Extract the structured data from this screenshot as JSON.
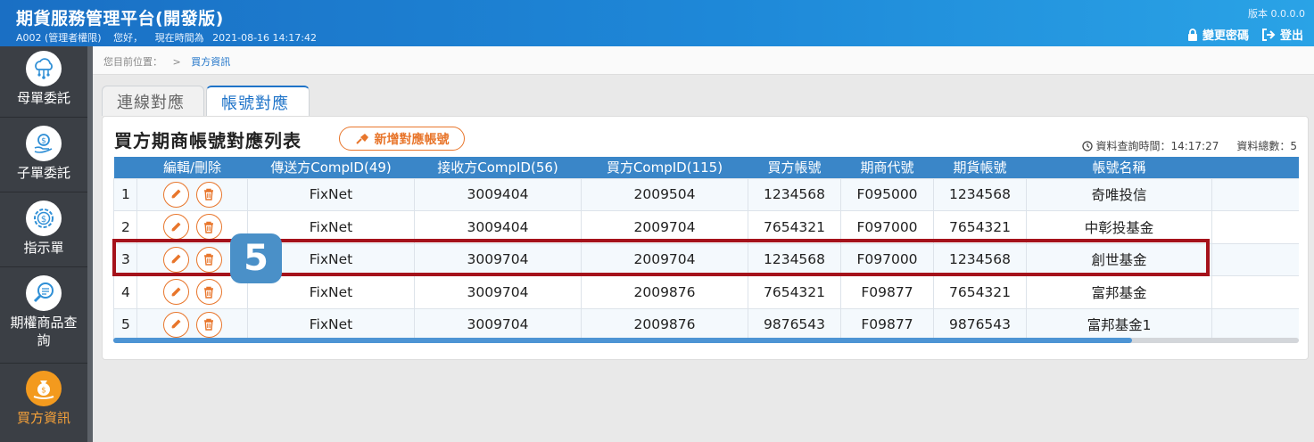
{
  "header": {
    "title": "期貨服務管理平台(開發版)",
    "user_id": "A002 (管理者權限)",
    "greeting": "您好，",
    "time_prefix": "現在時間為",
    "time": "2021-08-16 14:17:42",
    "version": "版本 0.0.0.0",
    "change_password": "變更密碼",
    "logout": "登出"
  },
  "sidebar": {
    "items": [
      {
        "label": "母單委託",
        "icon": "cloud-network-icon"
      },
      {
        "label": "子單委託",
        "icon": "money-hand-icon"
      },
      {
        "label": "指示單",
        "icon": "dollar-gear-icon"
      },
      {
        "label": "期權商品查詢",
        "icon": "magnify-chat-icon"
      },
      {
        "label": "買方資訊",
        "icon": "money-bag-hand-icon"
      }
    ]
  },
  "breadcrumb": {
    "prefix": "您目前位置：",
    "sep": ">",
    "current": "買方資訊"
  },
  "tabs": [
    {
      "label": "連線對應",
      "active": false
    },
    {
      "label": "帳號對應",
      "active": true
    }
  ],
  "card": {
    "title": "買方期商帳號對應列表",
    "add_button": "新增對應帳號",
    "query_time_label": "資料查詢時間：14:17:27",
    "total_label": "資料總數：5"
  },
  "table": {
    "headers": [
      "",
      "編輯/刪除",
      "傳送方CompID(49)",
      "接收方CompID(56)",
      "買方CompID(115)",
      "買方帳號",
      "期商代號",
      "期貨帳號",
      "帳號名稱",
      ""
    ],
    "rows": [
      [
        "1",
        "FixNet",
        "3009404",
        "2009504",
        "1234568",
        "F095000",
        "1234568",
        "奇唯投信"
      ],
      [
        "2",
        "FixNet",
        "3009404",
        "2009704",
        "7654321",
        "F097000",
        "7654321",
        "中彰投基金"
      ],
      [
        "3",
        "FixNet",
        "3009704",
        "2009704",
        "1234568",
        "F097000",
        "1234568",
        "創世基金"
      ],
      [
        "4",
        "FixNet",
        "3009704",
        "2009876",
        "7654321",
        "F09877",
        "7654321",
        "富邦基金"
      ],
      [
        "5",
        "FixNet",
        "3009704",
        "2009876",
        "9876543",
        "F09877",
        "9876543",
        "富邦基金1"
      ]
    ]
  },
  "annotation": {
    "step": "5",
    "color": "#a5121b"
  },
  "colors": {
    "header": "#1e88d8",
    "accent": "#e8762c",
    "table_header": "#3a86c8",
    "sidebar": "#3b3f45"
  }
}
